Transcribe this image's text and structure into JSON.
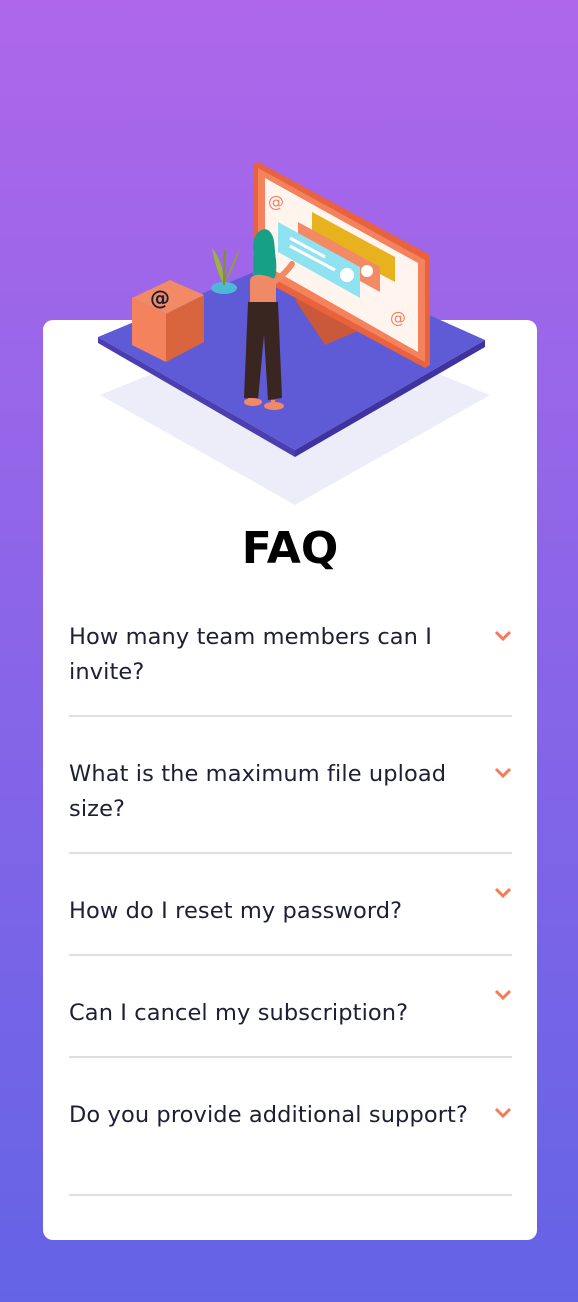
{
  "page": {
    "title": "FAQ"
  },
  "faq": {
    "items": [
      {
        "question": "How many team members can I invite?"
      },
      {
        "question": "What is the maximum file upload size?"
      },
      {
        "question": "How do I reset my password?"
      },
      {
        "question": "Can I cancel my subscription?"
      },
      {
        "question": "Do you provide additional support?"
      }
    ]
  },
  "colors": {
    "background_top": "#AE67EA",
    "background_bottom": "#6463E6",
    "chevron": "#F47B56",
    "question_text": "#1E1F36",
    "divider": "#DEDEE3"
  },
  "icons": {
    "chevron": "chevron-down-icon",
    "at_sign": "at-sign-icon"
  }
}
